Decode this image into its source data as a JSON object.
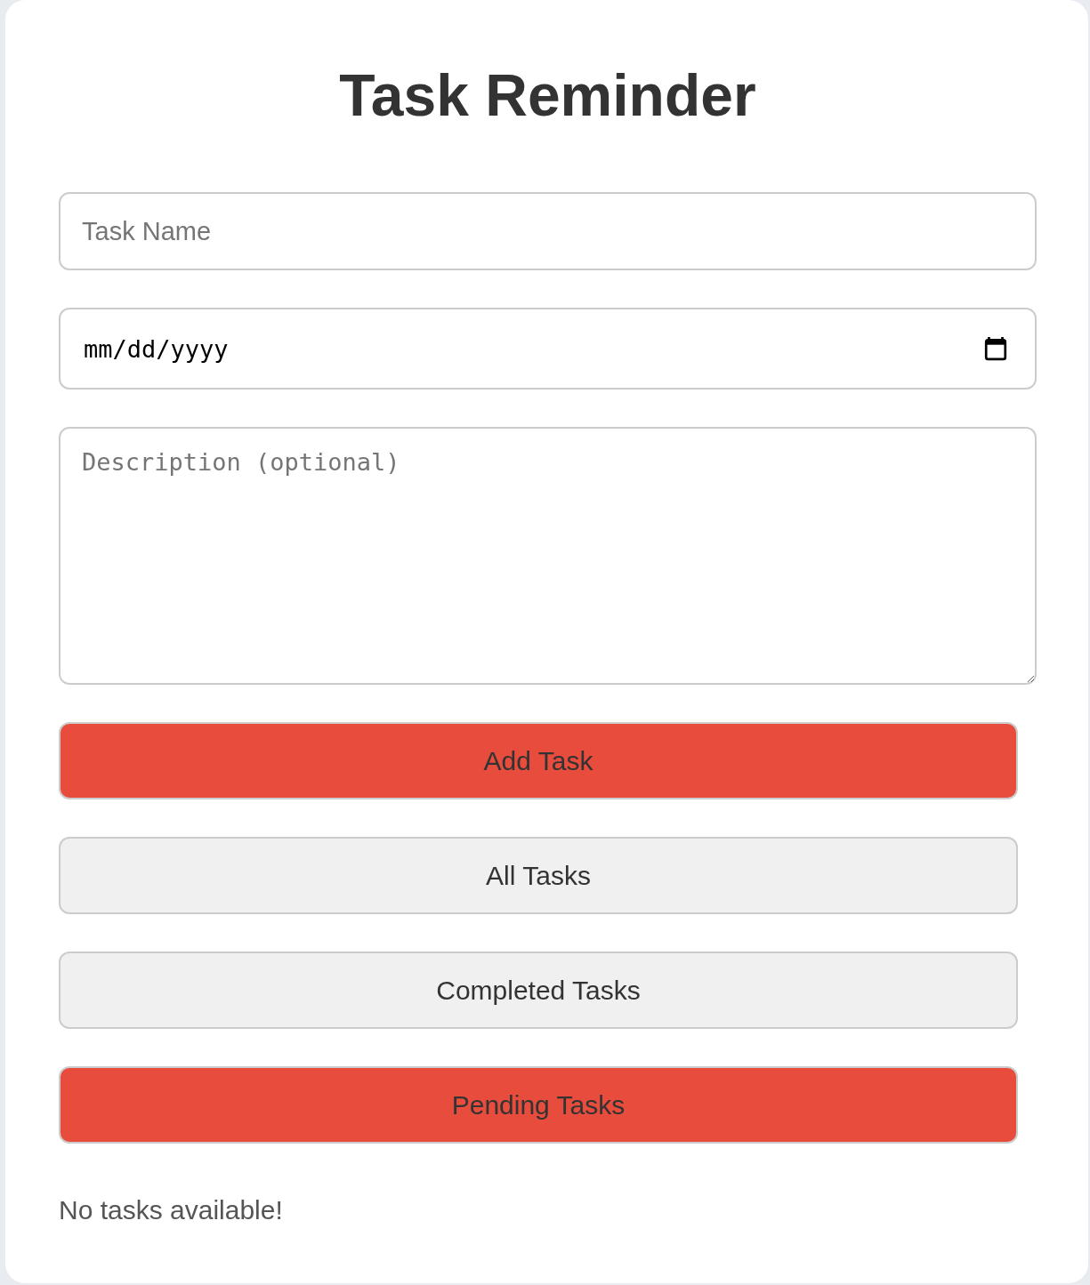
{
  "title": "Task Reminder",
  "form": {
    "task_name": {
      "placeholder": "Task Name"
    },
    "due_date": {
      "placeholder": "mm/dd/yyyy"
    },
    "description": {
      "placeholder": "Description (optional)"
    },
    "add_button": "Add Task"
  },
  "filters": [
    {
      "label": "All Tasks",
      "selected": false
    },
    {
      "label": "Completed Tasks",
      "selected": false
    },
    {
      "label": "Pending Tasks",
      "selected": true
    }
  ],
  "empty_message": "No tasks available!"
}
